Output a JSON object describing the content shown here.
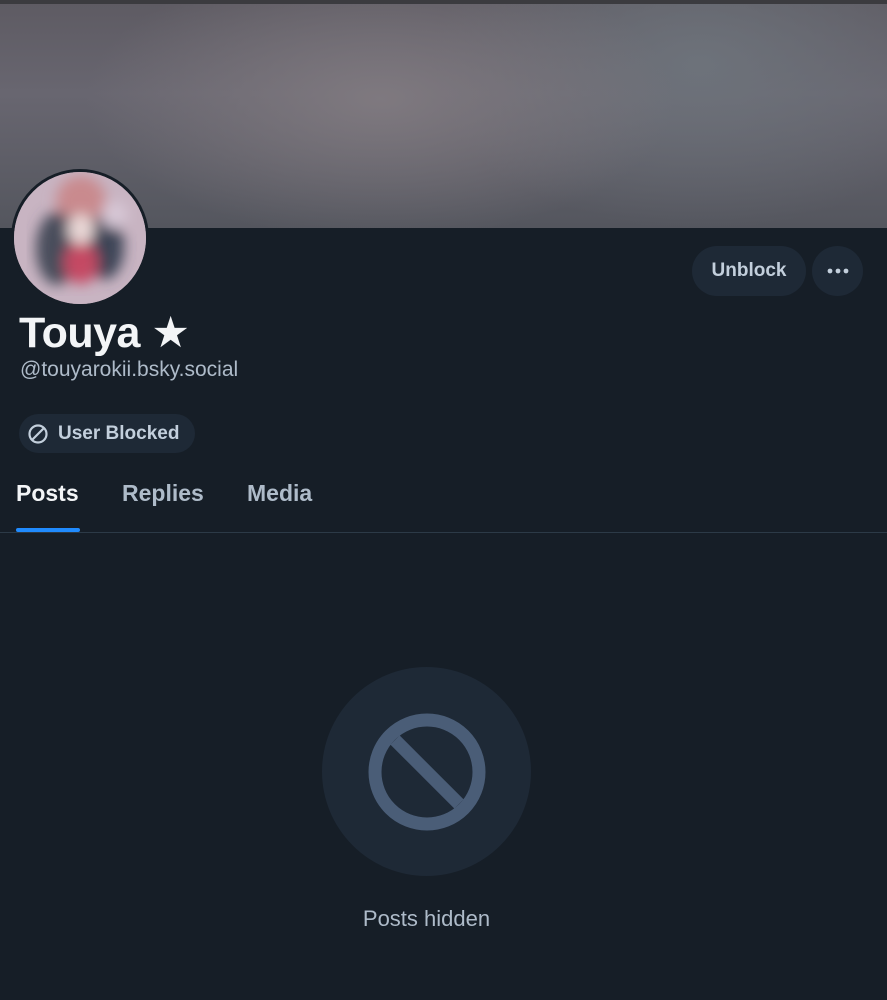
{
  "profile": {
    "display_name": "Touya ★",
    "handle": "@touyarokii.bsky.social",
    "status_badge": "User Blocked"
  },
  "actions": {
    "unblock_label": "Unblock",
    "more_icon": "ellipsis-icon"
  },
  "tabs": [
    {
      "label": "Posts",
      "active": true
    },
    {
      "label": "Replies",
      "active": false
    },
    {
      "label": "Media",
      "active": false
    }
  ],
  "empty_state": {
    "icon": "block-icon",
    "message": "Posts hidden"
  },
  "colors": {
    "background": "#161e27",
    "accent": "#208bfe",
    "muted_text": "#aebbc9",
    "icon": "#4a5d77"
  }
}
